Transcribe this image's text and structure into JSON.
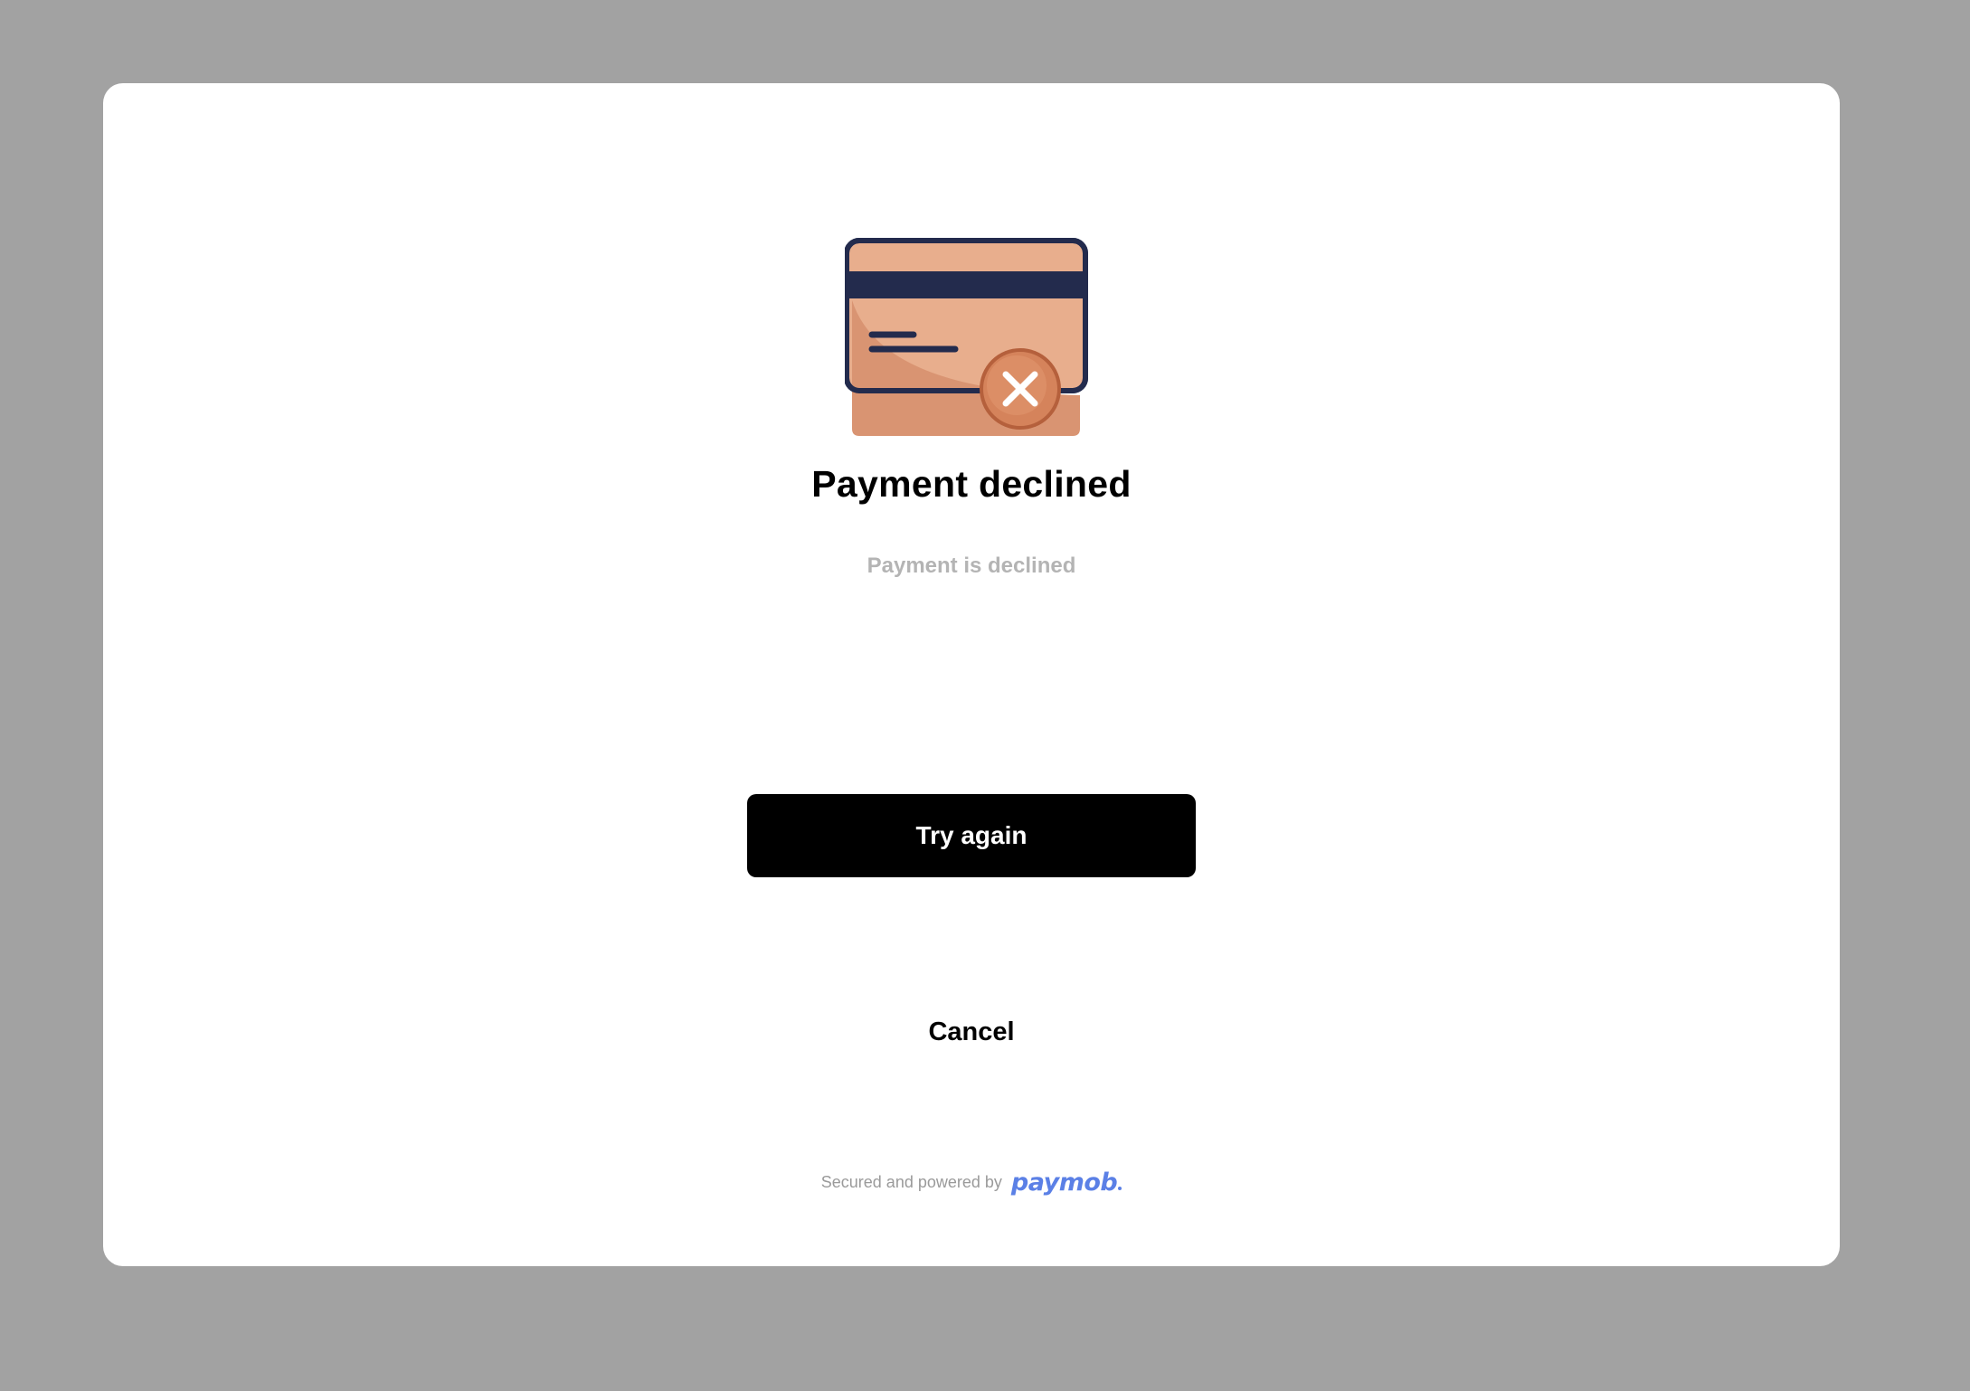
{
  "dialog": {
    "title": "Payment declined",
    "message": "Payment is declined",
    "try_again_label": "Try again",
    "cancel_label": "Cancel"
  },
  "footer": {
    "text": "Secured and powered by",
    "brand": "paymob"
  },
  "icons": {
    "illustration": "declined-credit-card-icon",
    "status": "close-icon"
  },
  "colors": {
    "overlay": "#a2a2a2",
    "dialog_bg": "#ffffff",
    "card_fill": "#e8ae8d",
    "card_shade": "#d99472",
    "card_outline": "#232b4d",
    "error_badge": "#d5835b",
    "error_badge_ring": "#b5603c",
    "primary_button": "#000000",
    "subtitle": "#b4b4b4",
    "brand": "#5b80e6"
  }
}
